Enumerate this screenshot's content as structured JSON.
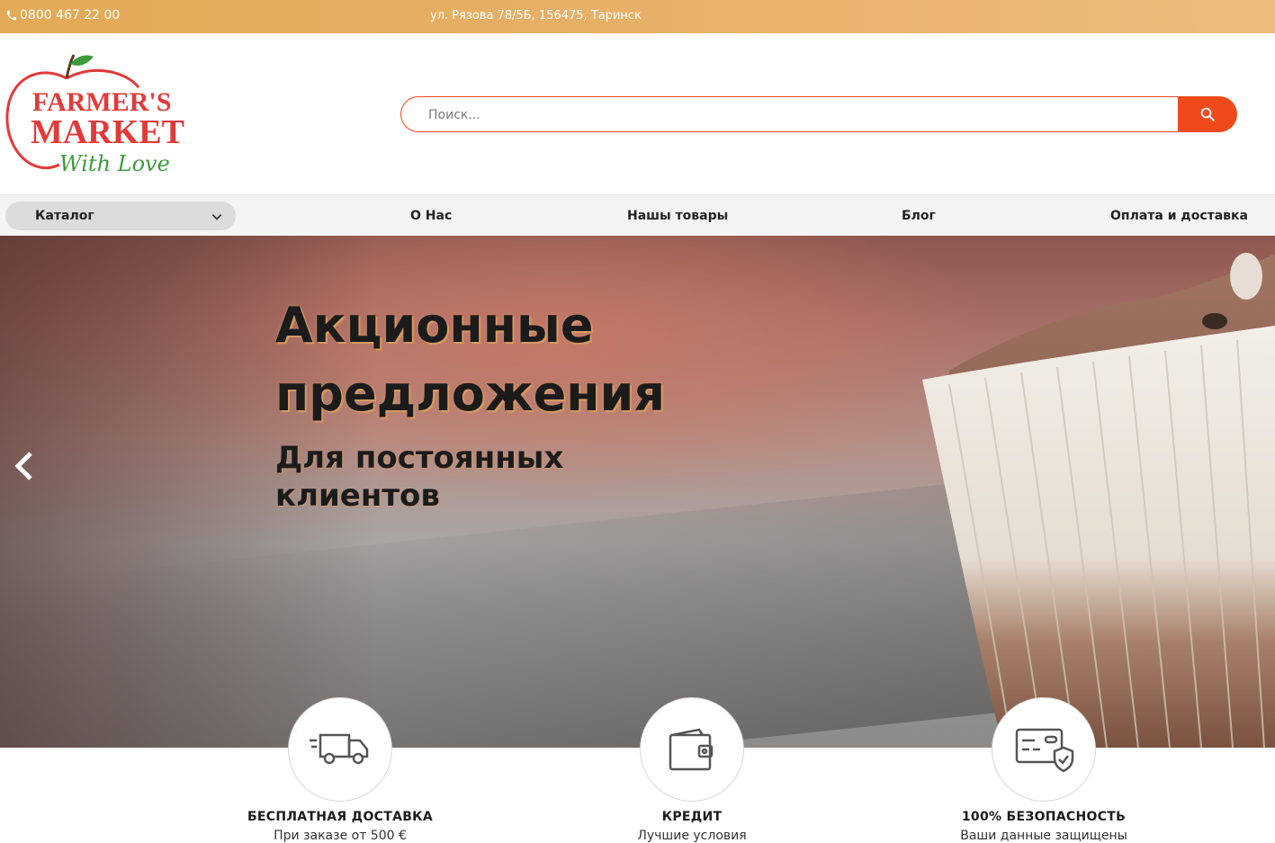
{
  "topbar": {
    "phone": "0800 467 22 00",
    "address": "ул. Рязова 78/5Б, 156475, Таринск"
  },
  "logo": {
    "line1": "FARMER'S",
    "line2": "MARKET",
    "line3": "With Love"
  },
  "search": {
    "placeholder": "Поиск...",
    "value": ""
  },
  "nav": {
    "catalog_label": "Каталог",
    "links": [
      "О Нас",
      "Нашы товары",
      "Блог",
      "Оплата и доставка"
    ]
  },
  "hero": {
    "title": "Акционные предложения",
    "subtitle": "Для постоянных клиентов"
  },
  "features": [
    {
      "icon": "truck-icon",
      "title": "БЕСПЛАТНАЯ ДОСТАВКА",
      "subtitle": "При заказе от 500 €"
    },
    {
      "icon": "wallet-icon",
      "title": "КРЕДИТ",
      "subtitle": "Лучшие условия"
    },
    {
      "icon": "secure-card-icon",
      "title": "100% БЕЗОПАСНОСТЬ",
      "subtitle": "Ваши данные защищены"
    }
  ],
  "colors": {
    "accent": "#f04a1c",
    "topbar": "#e7b068",
    "logo_red": "#e23a3a",
    "logo_green": "#3f9b3a"
  }
}
